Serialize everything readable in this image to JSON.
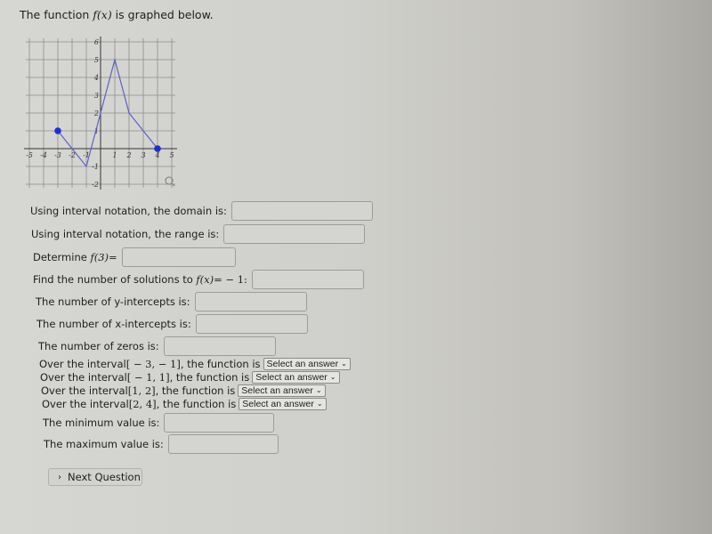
{
  "header": {
    "prefix": "The function ",
    "func": "f(x)",
    "suffix": " is graphed below."
  },
  "graph": {
    "x_ticks": [
      "-5",
      "-4",
      "-3",
      "-2",
      "-1",
      "1",
      "2",
      "3",
      "4",
      "5"
    ],
    "y_ticks": [
      "6",
      "5",
      "4",
      "3",
      "2",
      "1",
      "-1",
      "-2"
    ],
    "xlim": [
      -5,
      5
    ],
    "ylim": [
      -2,
      6
    ],
    "points": [
      [
        -3,
        1
      ],
      [
        -1,
        -1
      ],
      [
        0,
        2
      ],
      [
        1,
        5
      ],
      [
        2,
        2
      ],
      [
        4,
        0
      ]
    ],
    "endpoints": [
      [
        -3,
        1
      ],
      [
        4,
        0
      ]
    ],
    "line_color": "#5a63c8",
    "dot_color": "#1e2fcf",
    "magnify_icon": "magnifier-icon"
  },
  "questions": {
    "domain": "Using interval notation, the domain is:",
    "range": "Using interval notation, the range is:",
    "f3_prefix": "Determine ",
    "f3_math": "f(3)",
    "f3_suffix": " =",
    "solutions_prefix": "Find the number of solutions to ",
    "solutions_math": "f(x)",
    "solutions_suffix": " = − 1:",
    "y_intercepts": "The number of y-intercepts is:",
    "x_intercepts": "The number of x-intercepts is:",
    "zeros": "The number of zeros is:",
    "intervals": [
      {
        "prefix": "Over the interval ",
        "interval": "[ − 3,  − 1]",
        "suffix": ", the function is",
        "select": "Select an answer"
      },
      {
        "prefix": "Over the interval ",
        "interval": "[ − 1, 1]",
        "suffix": ", the function is",
        "select": "Select an answer"
      },
      {
        "prefix": "Over the interval ",
        "interval": "[1, 2]",
        "suffix": ", the function is",
        "select": "Select an answer"
      },
      {
        "prefix": "Over the interval ",
        "interval": "[2, 4]",
        "suffix": ", the function is",
        "select": "Select an answer"
      }
    ],
    "minimum": "The minimum value is:",
    "maximum": "The maximum value is:"
  },
  "inputs": {
    "domain": "",
    "range": "",
    "f3": "",
    "solutions": "",
    "y_intercepts": "",
    "x_intercepts": "",
    "zeros": "",
    "minimum": "",
    "maximum": ""
  },
  "next_button": "Next Question"
}
